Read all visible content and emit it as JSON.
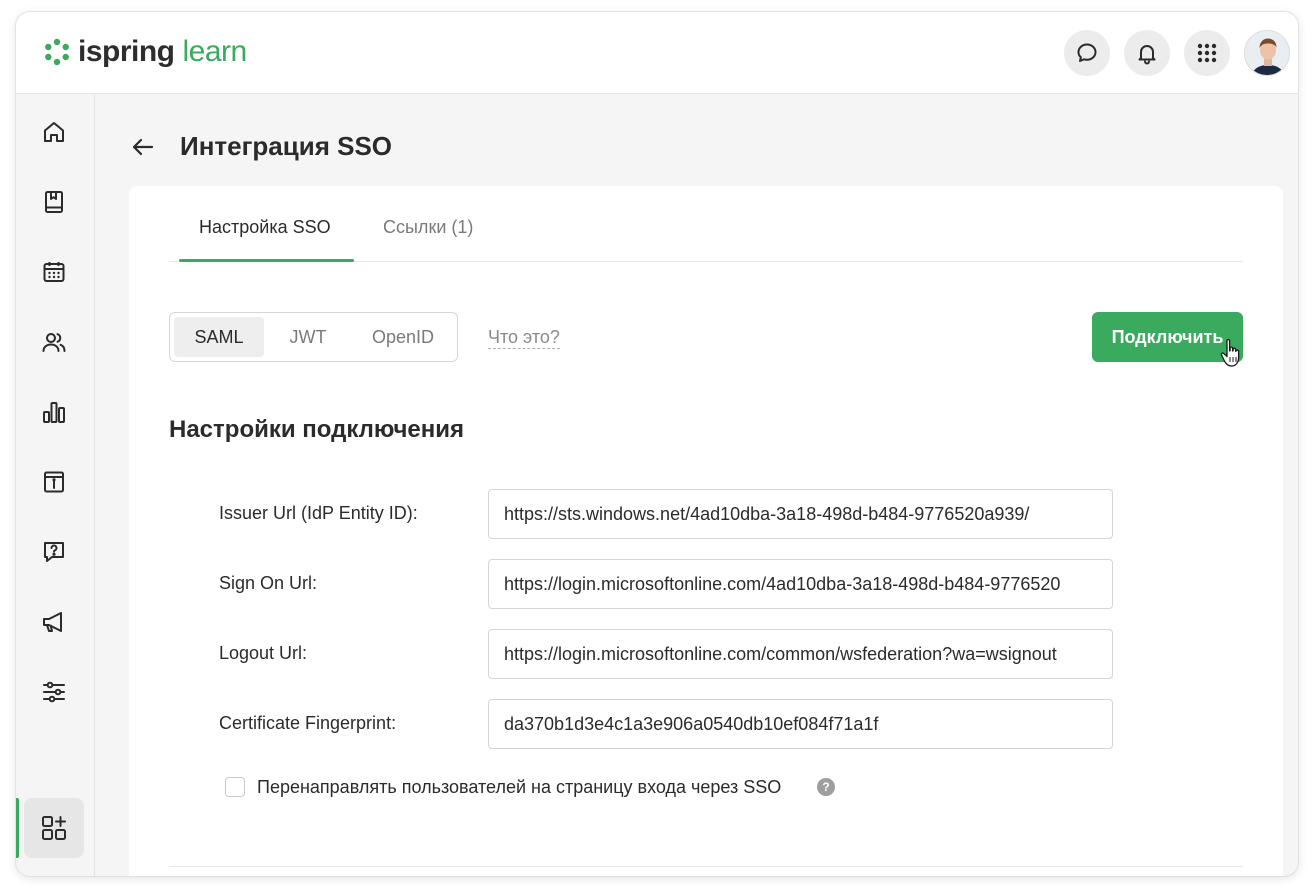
{
  "header": {
    "logo": {
      "part1": "ispring",
      "part2": "learn"
    },
    "buttons": [
      {
        "icon": "chat-icon"
      },
      {
        "icon": "bell-icon"
      },
      {
        "icon": "apps-grid-icon"
      }
    ],
    "avatar": "user-avatar"
  },
  "sidebar": {
    "items": [
      {
        "icon": "home-icon"
      },
      {
        "icon": "book-icon"
      },
      {
        "icon": "calendar-icon"
      },
      {
        "icon": "users-icon"
      },
      {
        "icon": "bar-chart-icon"
      },
      {
        "icon": "info-panel-icon"
      },
      {
        "icon": "question-chat-icon"
      },
      {
        "icon": "megaphone-icon"
      },
      {
        "icon": "sliders-icon"
      }
    ],
    "bottom_item": {
      "icon": "add-widget-icon",
      "active": true
    }
  },
  "page": {
    "title": "Интеграция SSO"
  },
  "tabs": [
    {
      "label": "Настройка SSO",
      "active": true
    },
    {
      "label": "Ссылки (1)",
      "active": false
    }
  ],
  "protocol": {
    "options": [
      "SAML",
      "JWT",
      "OpenID"
    ],
    "selected": "SAML",
    "help_link": "Что это?"
  },
  "connect_button": "Подключить",
  "section_title": "Настройки подключения",
  "form": {
    "issuer": {
      "label": "Issuer Url (IdP Entity ID):",
      "value": "https://sts.windows.net/4ad10dba-3a18-498d-b484-9776520a939/"
    },
    "sign_on": {
      "label": "Sign On Url:",
      "value": "https://login.microsoftonline.com/4ad10dba-3a18-498d-b484-9776520"
    },
    "logout": {
      "label": "Logout Url:",
      "value": "https://login.microsoftonline.com/common/wsfederation?wa=wsignout"
    },
    "fingerprint": {
      "label": "Certificate Fingerprint:",
      "value": "da370b1d3e4c1a3e906a0540db10ef084f71a1f"
    }
  },
  "redirect": {
    "label": "Перенаправлять пользователей на страницу входа через SSO",
    "checked": false,
    "help": "?"
  },
  "colors": {
    "accent": "#3aaa5e",
    "background": "#f5f5f5",
    "card": "#ffffff",
    "text": "#2b2b2b",
    "muted": "#7a7a7a"
  }
}
